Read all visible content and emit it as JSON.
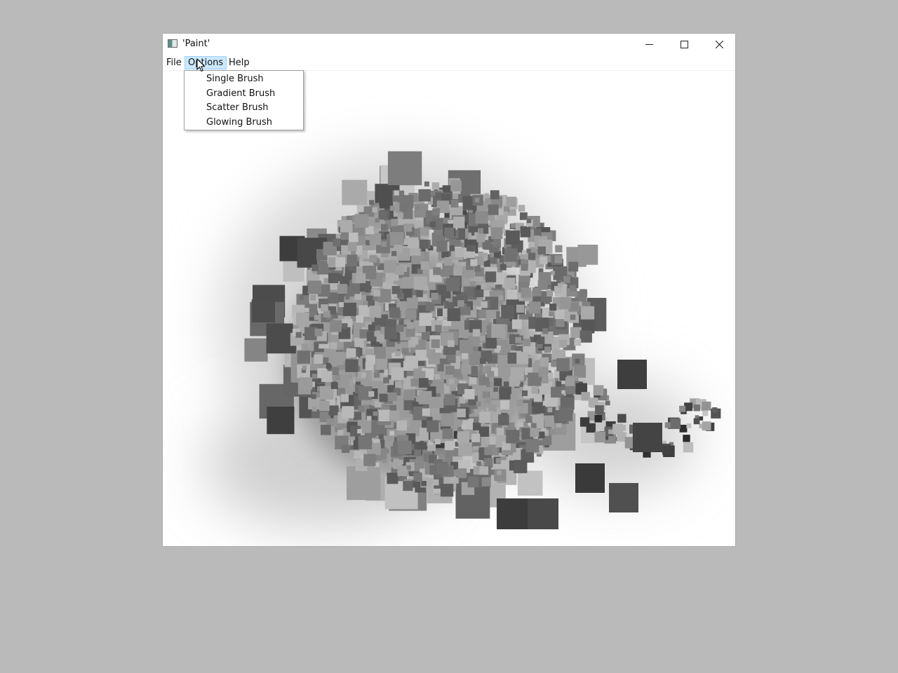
{
  "window": {
    "title": "'Paint'",
    "controls": {
      "minimize_icon": "minimize-icon",
      "maximize_icon": "maximize-icon",
      "close_icon": "close-icon"
    }
  },
  "menubar": {
    "items": [
      {
        "label": "File"
      },
      {
        "label": "Options",
        "active": true
      },
      {
        "label": "Help"
      }
    ]
  },
  "options_menu": {
    "items": [
      {
        "label": "Single Brush"
      },
      {
        "label": "Gradient Brush"
      },
      {
        "label": "Scatter Brush"
      },
      {
        "label": "Glowing Brush"
      }
    ]
  },
  "colors": {
    "desktop": "#bababa",
    "menu_highlight": "#cce8ff",
    "menu_highlight_border": "#99d1ff"
  }
}
